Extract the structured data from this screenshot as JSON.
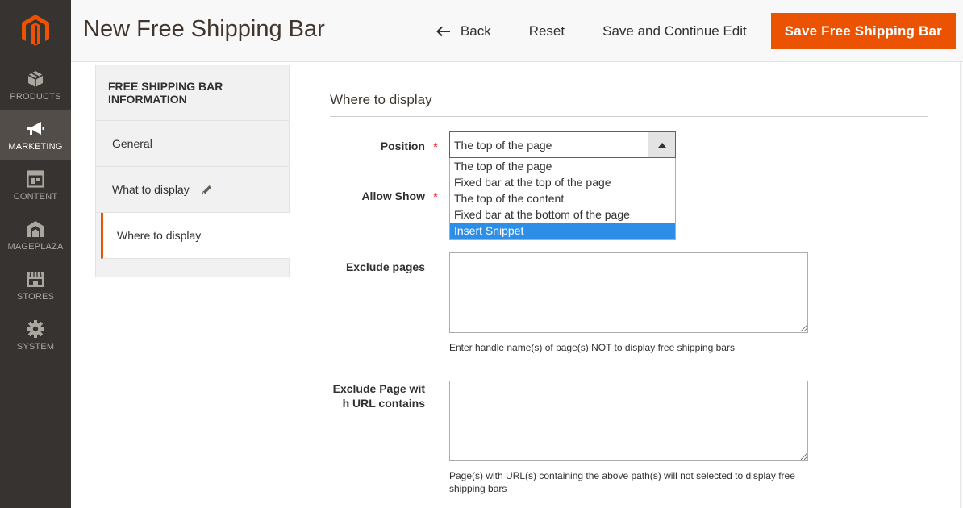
{
  "menu": {
    "items": [
      {
        "label": "PRODUCTS",
        "icon": "cube-icon",
        "active": false
      },
      {
        "label": "MARKETING",
        "icon": "megaphone-icon",
        "active": true
      },
      {
        "label": "CONTENT",
        "icon": "layout-icon",
        "active": false
      },
      {
        "label": "MAGEPLAZA",
        "icon": "mageplaza-icon",
        "active": false
      },
      {
        "label": "STORES",
        "icon": "store-icon",
        "active": false
      },
      {
        "label": "SYSTEM",
        "icon": "gear-icon",
        "active": false
      }
    ]
  },
  "header": {
    "title": "New Free Shipping Bar",
    "back_label": "Back",
    "reset_label": "Reset",
    "continue_label": "Save and Continue Edit",
    "save_label": "Save Free Shipping Bar"
  },
  "tabs": {
    "title": "FREE SHIPPING BAR INFORMATION",
    "items": [
      {
        "label": "General",
        "active": false,
        "changed": false
      },
      {
        "label": "What to display",
        "active": false,
        "changed": true
      },
      {
        "label": "Where to display",
        "active": true,
        "changed": false
      }
    ]
  },
  "form": {
    "section_title": "Where to display",
    "position": {
      "label": "Position",
      "value": "The top of the page",
      "options": [
        "The top of the page",
        "Fixed bar at the top of the page",
        "The top of the content",
        "Fixed bar at the bottom of the page",
        "Insert Snippet"
      ],
      "highlighted": "Insert Snippet"
    },
    "allow_show": {
      "label": "Allow Show"
    },
    "exclude_pages": {
      "label": "Exclude pages",
      "value": "",
      "note": "Enter handle name(s) of page(s) NOT to display free shipping bars"
    },
    "exclude_url": {
      "label_line1": "Exclude Page wit",
      "label_line2": "h URL contains",
      "value": "",
      "note": "Page(s) with URL(s) containing the above path(s) will not selected to display free shipping bars"
    },
    "required_mark": "*"
  },
  "colors": {
    "accent": "#eb5202",
    "menu_bg": "#373330",
    "focus": "#007bdb",
    "highlight": "#2c8ee6"
  }
}
